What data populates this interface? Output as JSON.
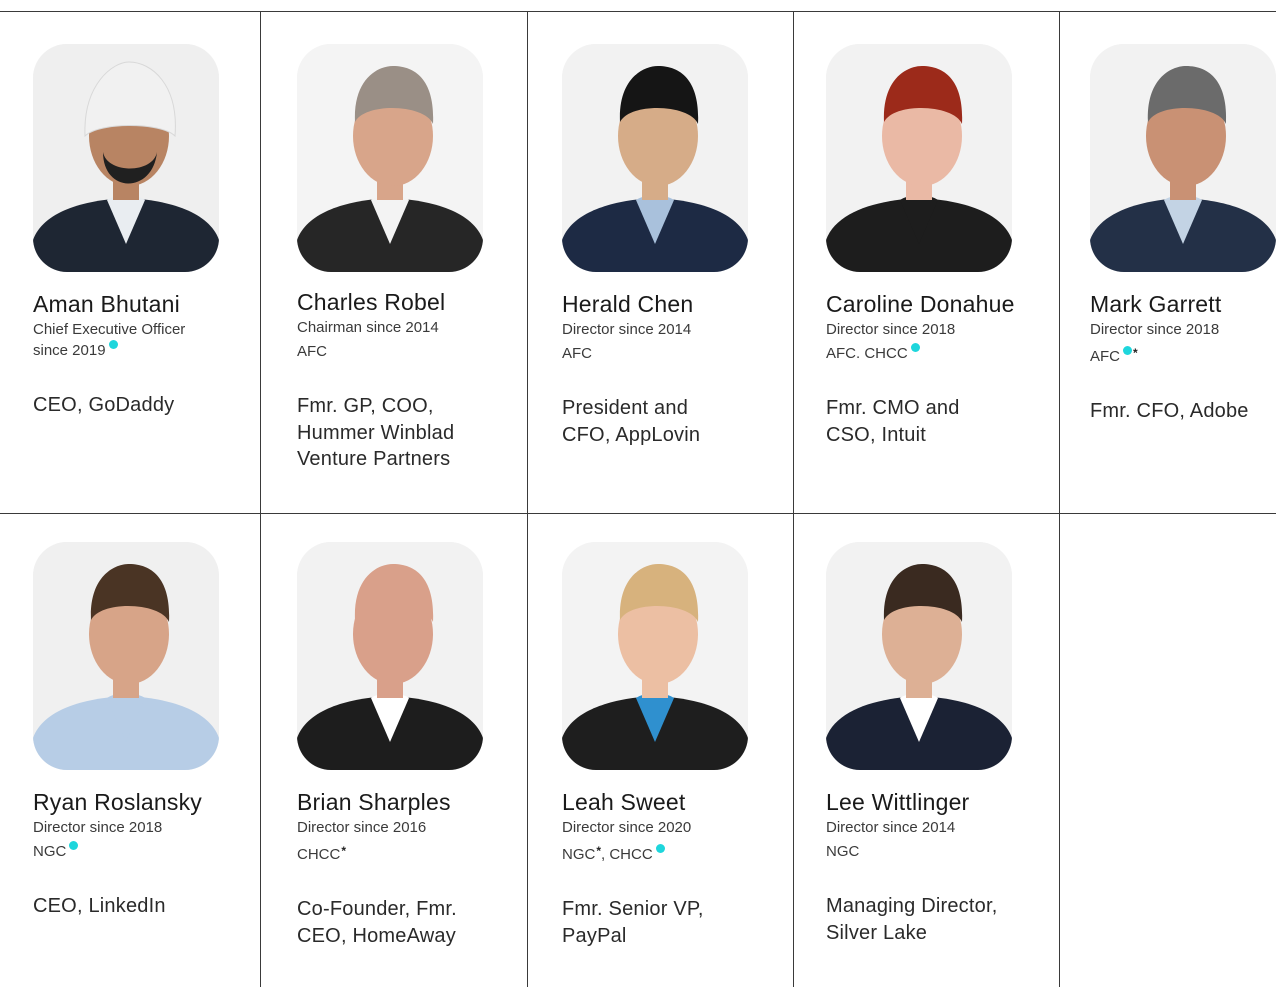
{
  "members": [
    {
      "name": "Aman Bhutani",
      "role": "Chief Executive Officer since 2019",
      "committees": "",
      "desc": "CEO, GoDaddy",
      "palette": {
        "bg": "#efefef",
        "skin": "#b88463",
        "hair": "#202020",
        "suit": "#1e2633",
        "shirt": "#e9edf1",
        "headwear": "#f1f1f1"
      }
    },
    {
      "name": "Charles Robel",
      "role": "Chairman since 2014",
      "committees": "AFC",
      "desc": "Fmr. GP, COO, Hummer Winblad Venture Partners",
      "palette": {
        "bg": "#f4f4f4",
        "skin": "#d8a58a",
        "hair": "#9a8f86",
        "suit": "#262626",
        "shirt": "#f3f3f3"
      }
    },
    {
      "name": "Herald Chen",
      "role": "Director since 2014",
      "committees": "AFC",
      "desc": "President and CFO, AppLovin",
      "palette": {
        "bg": "#f2f2f2",
        "skin": "#d6ac88",
        "hair": "#151515",
        "suit": "#1d2a44",
        "shirt": "#a9c1dc"
      }
    },
    {
      "name": "Caroline Donahue",
      "role": "Director since 2018",
      "committees": "AFC. CHCC",
      "desc": "Fmr. CMO and CSO, Intuit",
      "palette": {
        "bg": "#f2f2f2",
        "skin": "#eab9a5",
        "hair": "#9c2a1a",
        "suit": "#1d1d1d",
        "shirt": "#1d1d1d"
      }
    },
    {
      "name": "Mark Garrett",
      "role": "Director since 2018",
      "committees": "AFC",
      "desc": "Fmr. CFO, Adobe",
      "palette": {
        "bg": "#f2f2f2",
        "skin": "#c99174",
        "hair": "#6b6b6b",
        "suit": "#233047",
        "shirt": "#c3d3e4"
      }
    },
    {
      "name": "Ryan Roslansky",
      "role": "Director since 2018",
      "committees": "NGC",
      "desc": "CEO, LinkedIn",
      "palette": {
        "bg": "#f0f0f0",
        "skin": "#d7a488",
        "hair": "#4a3424",
        "suit": "#b7cde6",
        "shirt": "#b7cde6"
      }
    },
    {
      "name": "Brian Sharples",
      "role": "Director since 2016",
      "committees": "CHCC",
      "desc": "Co-Founder, Fmr. CEO, HomeAway",
      "palette": {
        "bg": "#f2f2f2",
        "skin": "#d9a08a",
        "hair": "#d9a08a",
        "suit": "#1d1d1d",
        "shirt": "#ffffff"
      }
    },
    {
      "name": "Leah Sweet",
      "role": "Director since 2020",
      "committees": "NGC",
      "committees_b": ", CHCC",
      "desc": "Fmr. Senior VP, PayPal",
      "palette": {
        "bg": "#f3f3f3",
        "skin": "#ecbfa3",
        "hair": "#d7b27d",
        "suit": "#1e1e1e",
        "shirt": "#2f90cf"
      }
    },
    {
      "name": "Lee Wittlinger",
      "role": "Director since 2014",
      "committees": "NGC",
      "desc": "Managing Director, Silver Lake",
      "palette": {
        "bg": "#f2f2f2",
        "skin": "#ddb095",
        "hair": "#3a2a20",
        "suit": "#1b2234",
        "shirt": "#ffffff"
      }
    }
  ],
  "legend_colors": {
    "independent_dot": "#1ed6dc"
  }
}
